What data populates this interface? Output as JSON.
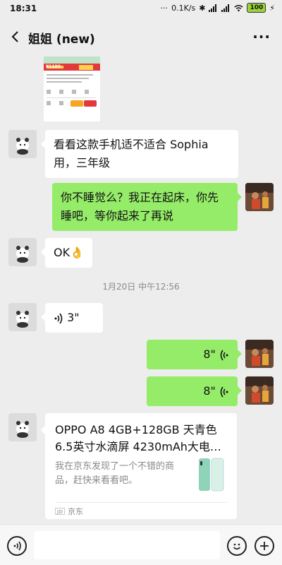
{
  "status_bar": {
    "time": "18:31",
    "net_speed": "0.1K/s",
    "battery": "100"
  },
  "header": {
    "title": "姐姐 (new)",
    "more_label": "···"
  },
  "messages": {
    "m1_text": "看看这款手机适不适合 Sophia 用，三年级",
    "m2_text": "你不睡觉么？我正在起床，你先睡吧，等你起来了再说",
    "m3_text": "OK👌",
    "timestamp": "1月20日 中午12:56",
    "voice_in_duration": "3\"",
    "voice_out_1_duration": "8\"",
    "voice_out_2_duration": "8\"",
    "product_price": "¥1199"
  },
  "link_card": {
    "title": "OPPO A8 4GB+128GB 天青色 6.5英寸水滴屏 4230mAh大电…",
    "description": "我在京东发现了一个不错的商品，赶快来看看吧。",
    "source_badge": "JD",
    "source": "京东"
  },
  "input_bar": {
    "placeholder": ""
  },
  "colors": {
    "background": "#ededed",
    "bubble_out": "#95ec69",
    "bubble_in": "#ffffff",
    "battery": "#9cd33b"
  },
  "icons": [
    "back-arrow-icon",
    "more-icon",
    "voice-wave-icon",
    "voice-mode-icon",
    "emoji-icon",
    "plus-icon"
  ]
}
